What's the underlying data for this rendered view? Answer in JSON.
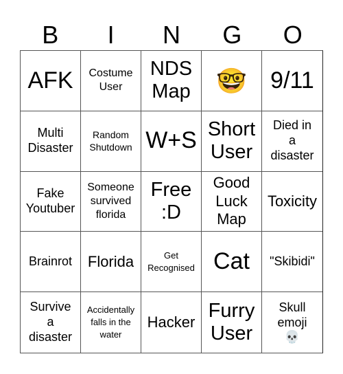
{
  "header": {
    "letters": [
      "B",
      "I",
      "N",
      "G",
      "O"
    ]
  },
  "board": {
    "rows": [
      [
        {
          "text": "AFK"
        },
        {
          "text": "Costume\nUser"
        },
        {
          "text": "NDS\nMap"
        },
        {
          "text": "🤓",
          "icon": "nerd-face-emoji-icon"
        },
        {
          "text": "9/11"
        }
      ],
      [
        {
          "text": "Multi\nDisaster"
        },
        {
          "text": "Random\nShutdown"
        },
        {
          "text": "W+S"
        },
        {
          "text": "Short\nUser"
        },
        {
          "text": "Died in\na\ndisaster"
        }
      ],
      [
        {
          "text": "Fake\nYoutuber"
        },
        {
          "text": "Someone\nsurvived\nflorida"
        },
        {
          "text": "Free\n:D"
        },
        {
          "text": "Good\nLuck\nMap"
        },
        {
          "text": "Toxicity"
        }
      ],
      [
        {
          "text": "Brainrot"
        },
        {
          "text": "Florida"
        },
        {
          "text": "Get\nRecognised"
        },
        {
          "text": "Cat"
        },
        {
          "text": "\"Skibidi\""
        }
      ],
      [
        {
          "text": "Survive\na\ndisaster"
        },
        {
          "text": "Accidentally\nfalls in the\nwater"
        },
        {
          "text": "Hacker"
        },
        {
          "text": "Furry\nUser"
        },
        {
          "text": "Skull\nemoji",
          "emoji": "💀",
          "icon": "skull-emoji-icon"
        }
      ]
    ]
  }
}
